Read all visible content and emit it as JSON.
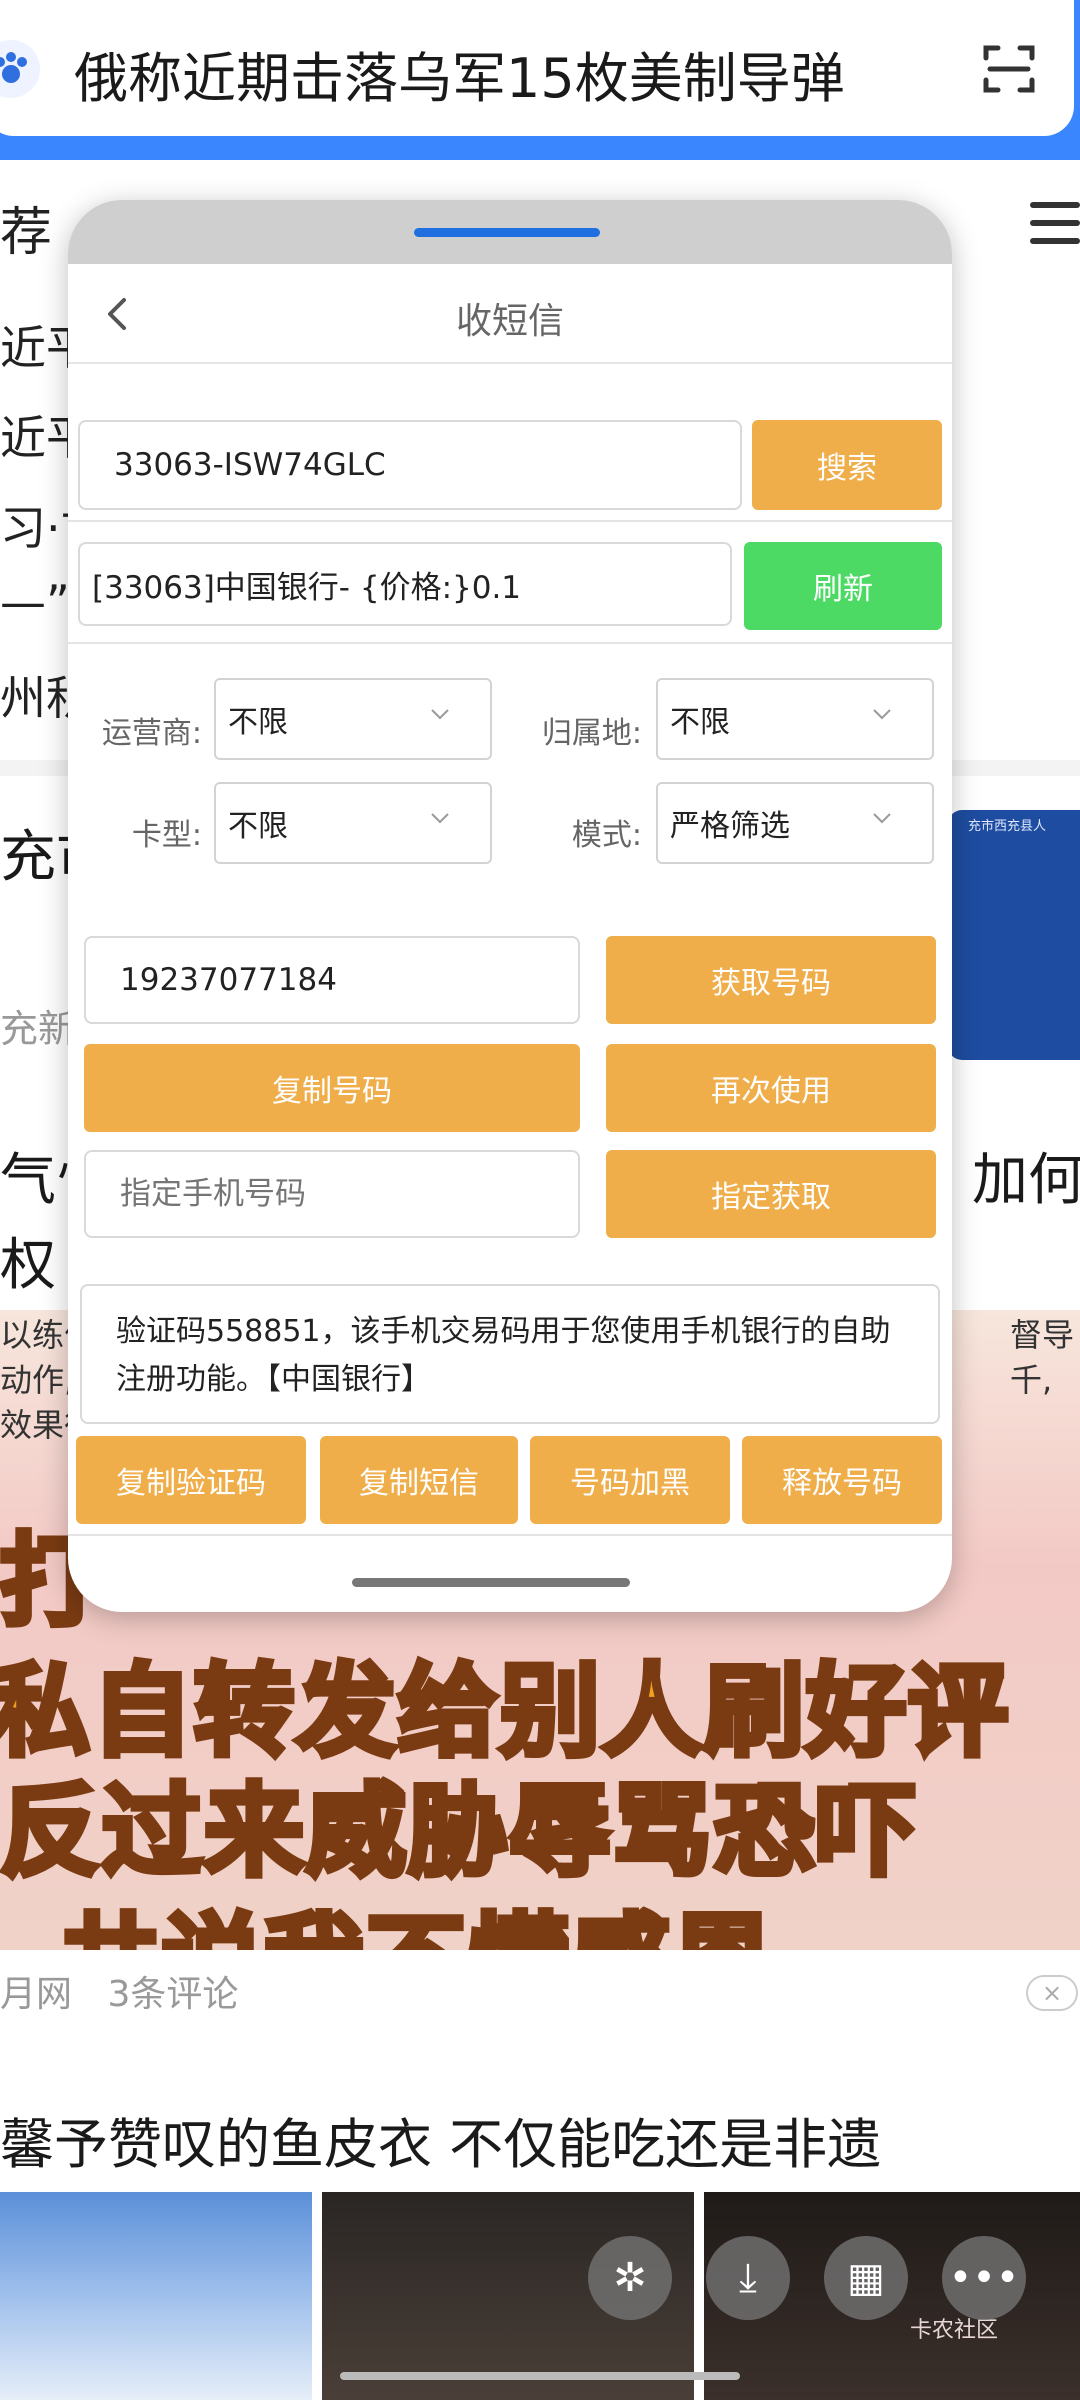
{
  "browser": {
    "search_query": "俄称近期击落乌军15枚美制导弹",
    "tab_first": "荐",
    "feed_lines": [
      "近平",
      "近平",
      "习·古",
      "—”",
      "州积"
    ],
    "article_1_snippet": "充市",
    "article_1_source": "充新闻",
    "blue_card_text": "充市西充县人",
    "article_2_line_1": "气忄",
    "article_2_line_1_right": "加何",
    "article_2_line_2": "权",
    "video_caption_lines": [
      "以练作",
      "动作,",
      "效果很"
    ],
    "video_caption_right": [
      "督导",
      "千,"
    ],
    "thumb_lines": [
      "打",
      "私自转发给别人刷好评",
      "反过来威胁辱骂恐吓",
      "共说我不懂感恩"
    ],
    "meta_source": "月网",
    "meta_comments": "3条评论",
    "close_ad": "×",
    "article_3_title": "馨予赞叹的鱼皮衣 不仅能吃还是非遗",
    "watermark": "卡农社区"
  },
  "modal": {
    "title": "收短信",
    "search_input_value": "33063-ISW74GLC",
    "search_button": "搜索",
    "project_value": "[33063]中国银行- {价格:}0.1",
    "refresh_button": "刷新",
    "filters": {
      "operator_label": "运营商:",
      "operator_value": "不限",
      "region_label": "归属地:",
      "region_value": "不限",
      "card_label": "卡型:",
      "card_value": "不限",
      "mode_label": "模式:",
      "mode_value": "严格筛选"
    },
    "phone_value": "19237077184",
    "get_number_button": "获取号码",
    "copy_number_button": "复制号码",
    "reuse_button": "再次使用",
    "assign_placeholder": "指定手机号码",
    "assign_button": "指定获取",
    "sms_text": "验证码558851，该手机交易码用于您使用手机银行的自助注册功能。【中国银行】",
    "copy_code_button": "复制验证码",
    "copy_sms_button": "复制短信",
    "blacklist_button": "号码加黑",
    "release_button": "释放号码"
  },
  "colors": {
    "accent_orange": "#f0ae4a",
    "refresh_green": "#4cd964",
    "browser_blue": "#3a86ff"
  }
}
